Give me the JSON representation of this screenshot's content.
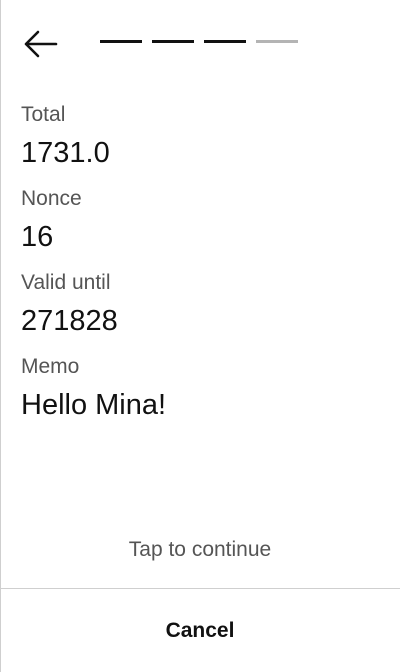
{
  "header": {
    "back_icon": "arrow-left-icon",
    "progress": {
      "total_steps": 4,
      "completed_steps": 3,
      "active_color": "#111111",
      "pending_color": "#b4b4b4"
    }
  },
  "details": {
    "fields": [
      {
        "label": "Total",
        "value": "1731.0"
      },
      {
        "label": "Nonce",
        "value": "16"
      },
      {
        "label": "Valid until",
        "value": "271828"
      },
      {
        "label": "Memo",
        "value": "Hello Mina!"
      }
    ]
  },
  "footer": {
    "tap_hint": "Tap to continue",
    "cancel_label": "Cancel"
  }
}
